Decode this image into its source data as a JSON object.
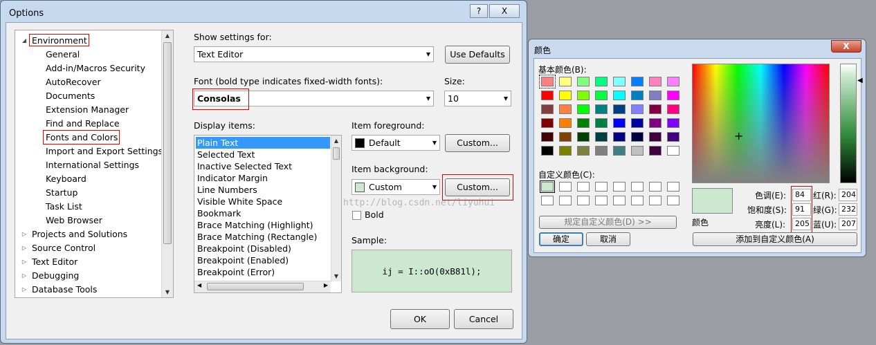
{
  "options": {
    "title": "Options",
    "help_glyph": "?",
    "close_glyph": "X",
    "tree": [
      {
        "label": "Environment",
        "expanded": true
      },
      {
        "label": "General"
      },
      {
        "label": "Add-in/Macros Security"
      },
      {
        "label": "AutoRecover"
      },
      {
        "label": "Documents"
      },
      {
        "label": "Extension Manager"
      },
      {
        "label": "Find and Replace"
      },
      {
        "label": "Fonts and Colors"
      },
      {
        "label": "Import and Export Settings"
      },
      {
        "label": "International Settings"
      },
      {
        "label": "Keyboard"
      },
      {
        "label": "Startup"
      },
      {
        "label": "Task List"
      },
      {
        "label": "Web Browser"
      },
      {
        "label": "Projects and Solutions",
        "expanded": false
      },
      {
        "label": "Source Control",
        "expanded": false
      },
      {
        "label": "Text Editor",
        "expanded": false
      },
      {
        "label": "Debugging",
        "expanded": false
      },
      {
        "label": "Database Tools",
        "expanded": false
      }
    ],
    "show_settings_label": "Show settings for:",
    "show_settings_value": "Text Editor",
    "use_defaults_label": "Use Defaults",
    "font_label": "Font (bold type indicates fixed-width fonts):",
    "font_value": "Consolas",
    "size_label": "Size:",
    "size_value": "10",
    "display_items_label": "Display items:",
    "display_items": [
      "Plain Text",
      "Selected Text",
      "Inactive Selected Text",
      "Indicator Margin",
      "Line Numbers",
      "Visible White Space",
      "Bookmark",
      "Brace Matching (Highlight)",
      "Brace Matching (Rectangle)",
      "Breakpoint (Disabled)",
      "Breakpoint (Enabled)",
      "Breakpoint (Error)"
    ],
    "fg_label": "Item foreground:",
    "fg_value": "Default",
    "fg_color": "#000000",
    "bg_label": "Item background:",
    "bg_value": "Custom",
    "bg_color": "#cce8cf",
    "custom_label": "Custom...",
    "bold_label": "Bold",
    "sample_label": "Sample:",
    "sample_text": "ij = I::oO(0xB81l);",
    "ok_label": "OK",
    "cancel_label": "Cancel",
    "watermark": "http://blog.csdn.net/liyuhui"
  },
  "color_dialog": {
    "title": "颜色",
    "close_glyph": "X",
    "basic_label": "基本颜色(B):",
    "basic_colors": [
      [
        "#ff8080",
        "#ffff80",
        "#80ff80",
        "#00ff80",
        "#80ffff",
        "#0080ff",
        "#ff80c0",
        "#ff80ff"
      ],
      [
        "#ff0000",
        "#ffff00",
        "#80ff00",
        "#00ff40",
        "#00ffff",
        "#0080c0",
        "#8080c0",
        "#ff00ff"
      ],
      [
        "#804040",
        "#ff8040",
        "#00ff00",
        "#008080",
        "#004080",
        "#8080ff",
        "#800040",
        "#ff0080"
      ],
      [
        "#800000",
        "#ff8000",
        "#008000",
        "#008040",
        "#0000ff",
        "#0000a0",
        "#800080",
        "#8000ff"
      ],
      [
        "#400000",
        "#804000",
        "#004000",
        "#004040",
        "#000080",
        "#000040",
        "#400040",
        "#400080"
      ],
      [
        "#000000",
        "#808000",
        "#808040",
        "#808080",
        "#408080",
        "#c0c0c0",
        "#400040",
        "#ffffff"
      ]
    ],
    "custom_label": "自定义颜色(C):",
    "custom_first_color": "#cce8cf",
    "define_custom_label": "规定自定义颜色(D) >>",
    "ok_label": "确定",
    "cancel_label": "取消",
    "preview_color": "#cce8cf",
    "preview_label": "颜色",
    "hue_label": "色调(E):",
    "hue_value": "84",
    "sat_label": "饱和度(S):",
    "sat_value": "91",
    "lum_label": "亮度(L):",
    "lum_value": "205",
    "red_label": "红(R):",
    "red_value": "204",
    "green_label": "绿(G):",
    "green_value": "232",
    "blue_label": "蓝(U):",
    "blue_value": "207",
    "add_custom_label": "添加到自定义颜色(A)",
    "crosshair_glyph": "+"
  }
}
